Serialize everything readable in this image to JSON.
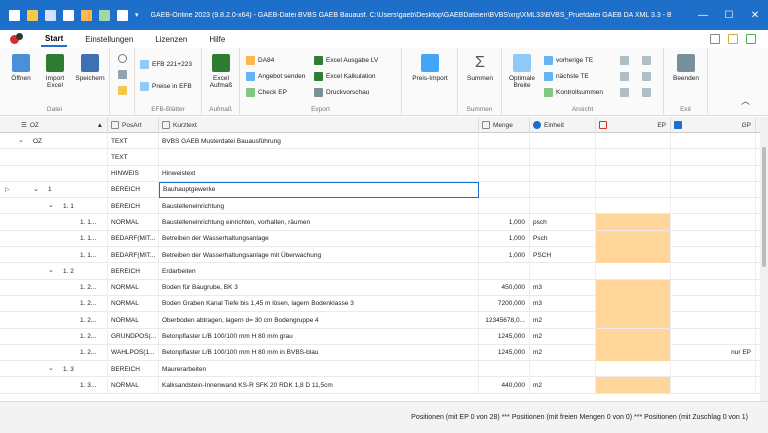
{
  "titlebar": {
    "title": "GAEB-Online 2023 (9.8.2.0-x64) - GAEB-Datei  BVBS GAEB Bauausf.  C:\\Users\\gaeb\\Desktop\\GAEBDateien\\BVBS\\xrg\\XML33\\BVBS_Pruefdatei GAEB DA XML 3.3 - Bauausf...",
    "minimize": "—",
    "maximize": "☐",
    "close": "✕"
  },
  "menu": {
    "tabs": [
      "Start",
      "Einstellungen",
      "Lizenzen",
      "Hilfe"
    ]
  },
  "ribbon": {
    "datei": {
      "label": "Datei",
      "oeffnen": "Öffnen",
      "import": "Import\nExcel",
      "speichern": "Speichern"
    },
    "efb": {
      "label": "EFB-Blätter",
      "efb221": "EFB 221+223",
      "preise": "Preise in EFB"
    },
    "aufmass": {
      "label": "Aufmaß",
      "excel": "Excel\nAufmaß"
    },
    "export": {
      "label": "Export",
      "da84": "DA84",
      "angebot": "Angebot senden",
      "checkep": "Check EP",
      "excelausgabe": "Excel Ausgabe LV",
      "excelkalk": "Excel Kalkulation",
      "druck": "Druckvorschau"
    },
    "preis": {
      "import": "Preis-Import"
    },
    "summen": {
      "label": "Summen",
      "btn": "Summen"
    },
    "ansicht": {
      "label": "Ansicht",
      "optimale": "Optimale\nBreite",
      "vorherige": "vorherige TE",
      "naechste": "nächste TE",
      "kontroll": "Kontrollsummen"
    },
    "exit": {
      "label": "Exit",
      "beenden": "Beenden"
    }
  },
  "grid": {
    "headers": {
      "oz": "OZ",
      "posart": "PosArt",
      "kurztext": "Kurztext",
      "menge": "Menge",
      "einheit": "Einheit",
      "ep": "EP",
      "gp": "GP"
    },
    "rows": [
      {
        "oz": "OZ",
        "posart": "TEXT",
        "kurztext": "BVBS GAEB Musterdatei Bauausführung",
        "menge": "",
        "einheit": "",
        "gp": "",
        "orange": false,
        "tog": "⌄",
        "indent": 0
      },
      {
        "oz": "",
        "posart": "TEXT",
        "kurztext": "",
        "menge": "",
        "einheit": "",
        "gp": "",
        "orange": false,
        "tog": "",
        "indent": 0
      },
      {
        "oz": "",
        "posart": "HINWEIS",
        "kurztext": "Hinweistext",
        "menge": "",
        "einheit": "",
        "gp": "",
        "orange": false,
        "tog": "",
        "indent": 0
      },
      {
        "oz": "1",
        "posart": "BEREICH",
        "kurztext": "Bauhauptgewerke",
        "menge": "",
        "einheit": "",
        "gp": "",
        "orange": false,
        "tog": "⌄",
        "indent": 1,
        "selected": true
      },
      {
        "oz": "1. 1",
        "posart": "BEREICH",
        "kurztext": "Baustelleneinrichtung",
        "menge": "",
        "einheit": "",
        "gp": "",
        "orange": false,
        "tog": "⌄",
        "indent": 2
      },
      {
        "oz": "1. 1...",
        "posart": "NORMAL",
        "kurztext": "Baustelleneinrichtung einrichten, vorhalten, räumen",
        "menge": "1,000",
        "einheit": "psch",
        "gp": "",
        "orange": true,
        "tog": "",
        "indent": 3
      },
      {
        "oz": "1. 1...",
        "posart": "BEDARF(MIT...",
        "kurztext": "Betreiben der Wasserhaltungsanlage",
        "menge": "1,000",
        "einheit": "Psch",
        "gp": "",
        "orange": true,
        "tog": "",
        "indent": 3
      },
      {
        "oz": "1. 1...",
        "posart": "BEDARF(MIT...",
        "kurztext": "Betreiben der Wasserhaltungsanlage mit Überwachung",
        "menge": "1,000",
        "einheit": "PSCH",
        "gp": "",
        "orange": true,
        "tog": "",
        "indent": 3
      },
      {
        "oz": "1. 2",
        "posart": "BEREICH",
        "kurztext": "Erdarbeiten",
        "menge": "",
        "einheit": "",
        "gp": "",
        "orange": false,
        "tog": "⌄",
        "indent": 2
      },
      {
        "oz": "1. 2...",
        "posart": "NORMAL",
        "kurztext": "Boden für Baugrube, BK 3",
        "menge": "450,000",
        "einheit": "m3",
        "gp": "",
        "orange": true,
        "tog": "",
        "indent": 3
      },
      {
        "oz": "1. 2...",
        "posart": "NORMAL",
        "kurztext": "Boden Graben Kanal Tiefe bis 1,45 m lösen, lagern Bodenklasse 3",
        "menge": "7200,000",
        "einheit": "m3",
        "gp": "",
        "orange": true,
        "tog": "",
        "indent": 3
      },
      {
        "oz": "1. 2...",
        "posart": "NORMAL",
        "kurztext": "Oberboden abtragen, lagern d= 30 cm Bodengruppe 4",
        "menge": "12345678,0...",
        "einheit": "m2",
        "gp": "",
        "orange": true,
        "tog": "",
        "indent": 3
      },
      {
        "oz": "1. 2...",
        "posart": "GRUNDPOS(...",
        "kurztext": "Betonpflaster L/B 100/100 mm H 80 mm  grau",
        "menge": "1245,000",
        "einheit": "m2",
        "gp": "",
        "orange": true,
        "tog": "",
        "indent": 3
      },
      {
        "oz": "1. 2...",
        "posart": "WAHLPOS(1...",
        "kurztext": "Betonpflaster L/B 100/100 mm H 80 mm  in BVBS-blau",
        "menge": "1245,000",
        "einheit": "m2",
        "gp": "nur EP",
        "orange": true,
        "tog": "",
        "indent": 3
      },
      {
        "oz": "1. 3",
        "posart": "BEREICH",
        "kurztext": "Maurerarbeiten",
        "menge": "",
        "einheit": "",
        "gp": "",
        "orange": false,
        "tog": "⌄",
        "indent": 2
      },
      {
        "oz": "1. 3...",
        "posart": "NORMAL",
        "kurztext": "Kalksandstein-Innenwand KS-R SFK 20 RDK 1,8 D 11,5cm",
        "menge": "440,000",
        "einheit": "m2",
        "gp": "",
        "orange": true,
        "tog": "",
        "indent": 3
      }
    ]
  },
  "status": {
    "text": "Positionen (mit EP 0 von 28) *** Positionen (mit freien Mengen 0 von 0) *** Positionen (mit Zuschlag 0 von 1)"
  }
}
